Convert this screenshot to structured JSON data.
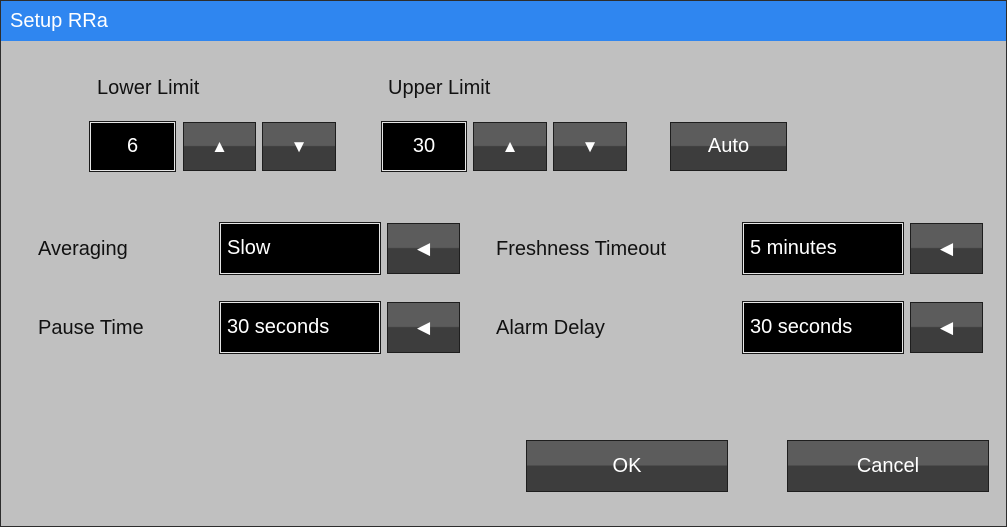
{
  "window": {
    "title": "Setup RRa"
  },
  "limits": {
    "lower": {
      "label": "Lower Limit",
      "value": "6",
      "up_icon": "up-triangle-icon",
      "down_icon": "down-triangle-icon"
    },
    "upper": {
      "label": "Upper Limit",
      "value": "30",
      "up_icon": "up-triangle-icon",
      "down_icon": "down-triangle-icon"
    },
    "auto_label": "Auto"
  },
  "settings": {
    "averaging": {
      "label": "Averaging",
      "value": "Slow"
    },
    "pause_time": {
      "label": "Pause Time",
      "value": "30 seconds"
    },
    "freshness_timeout": {
      "label": "Freshness Timeout",
      "value": "5 minutes"
    },
    "alarm_delay": {
      "label": "Alarm Delay",
      "value": "30 seconds"
    }
  },
  "icons": {
    "up": "▲",
    "down": "▼",
    "select": "◀"
  },
  "actions": {
    "ok_label": "OK",
    "cancel_label": "Cancel"
  },
  "colors": {
    "titlebar": "#2f86f0",
    "background": "#c0c0c0",
    "field": "#000000",
    "button": "#4a4a4a"
  }
}
